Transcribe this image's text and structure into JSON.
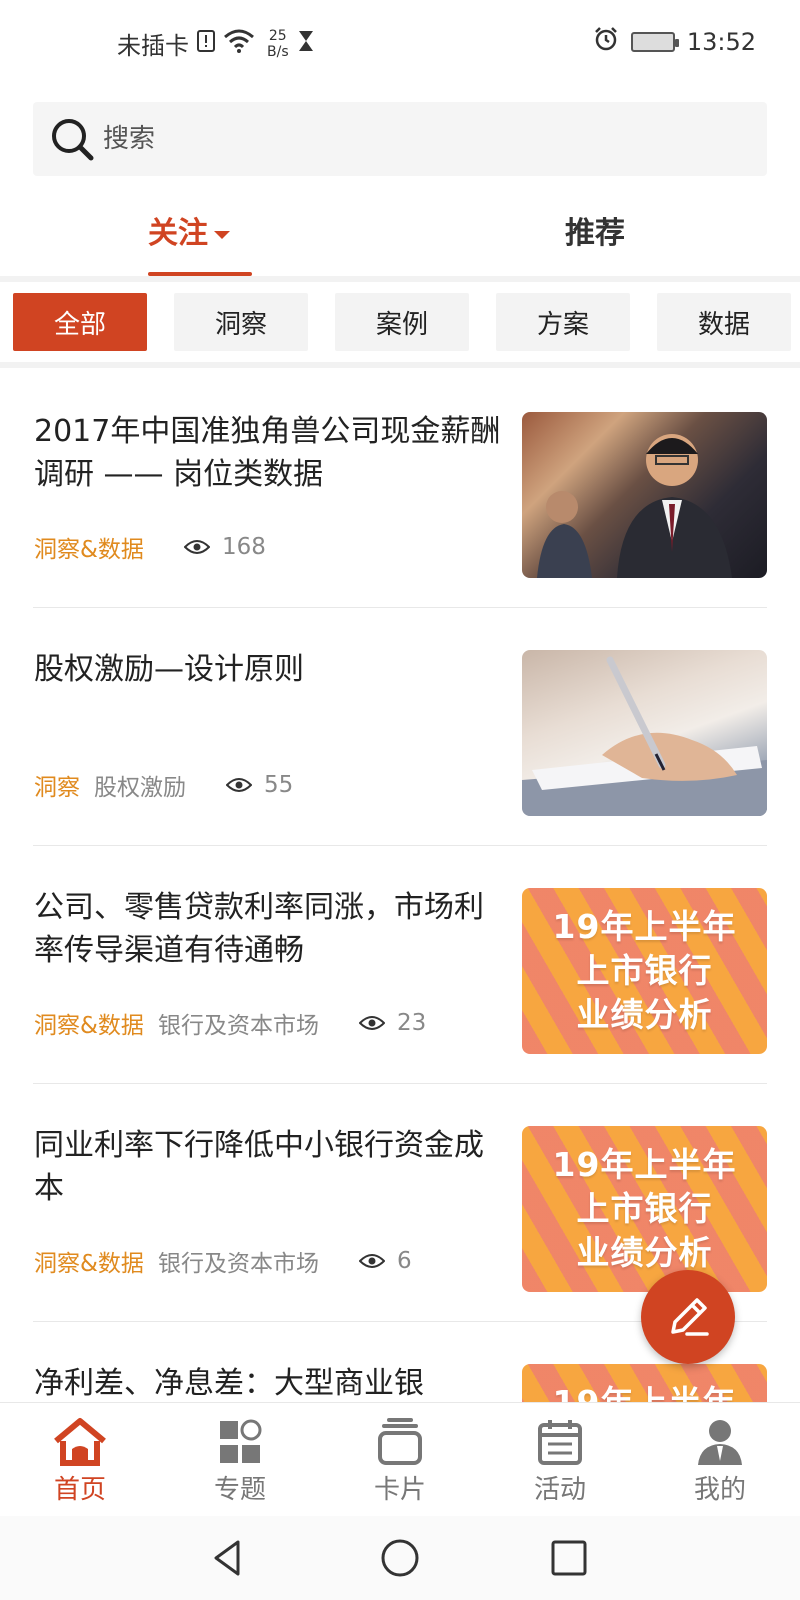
{
  "status_bar": {
    "carrier": "未插卡",
    "speed_value": "25",
    "speed_unit": "B/s",
    "time": "13:52"
  },
  "search": {
    "placeholder": "搜索"
  },
  "top_tabs": [
    {
      "label": "关注",
      "active": true
    },
    {
      "label": "推荐",
      "active": false
    }
  ],
  "filters": [
    {
      "label": "全部",
      "active": true
    },
    {
      "label": "洞察",
      "active": false
    },
    {
      "label": "案例",
      "active": false
    },
    {
      "label": "方案",
      "active": false
    },
    {
      "label": "数据",
      "active": false
    }
  ],
  "articles": [
    {
      "title": "2017年中国准独角兽公司现金薪酬调研 —— 岗位类数据",
      "category": "洞察&数据",
      "tag": "",
      "views": "168",
      "thumb": "portrait-photo"
    },
    {
      "title": "股权激励—设计原则",
      "category": "洞察",
      "tag": "股权激励",
      "views": "55",
      "thumb": "writing-photo"
    },
    {
      "title": "公司、零售贷款利率同涨，市场利率传导渠道有待通畅",
      "category": "洞察&数据",
      "tag": "银行及资本市场",
      "views": "23",
      "thumb": "banner"
    },
    {
      "title": "同业利率下行降低中小银行资金成本",
      "category": "洞察&数据",
      "tag": "银行及资本市场",
      "views": "6",
      "thumb": "banner"
    },
    {
      "title": "净利差、净息差：大型商业银",
      "category": "",
      "tag": "",
      "views": "",
      "thumb": "banner"
    }
  ],
  "banner_text": [
    "19年上半年",
    "上市银行",
    "业绩分析"
  ],
  "bottom_nav": [
    {
      "label": "首页",
      "icon": "home-icon",
      "active": true
    },
    {
      "label": "专题",
      "icon": "topics-icon",
      "active": false
    },
    {
      "label": "卡片",
      "icon": "cards-icon",
      "active": false
    },
    {
      "label": "活动",
      "icon": "calendar-icon",
      "active": false
    },
    {
      "label": "我的",
      "icon": "profile-icon",
      "active": false
    }
  ],
  "colors": {
    "accent": "#d04422",
    "category": "#e08a1e",
    "muted": "#888888"
  }
}
